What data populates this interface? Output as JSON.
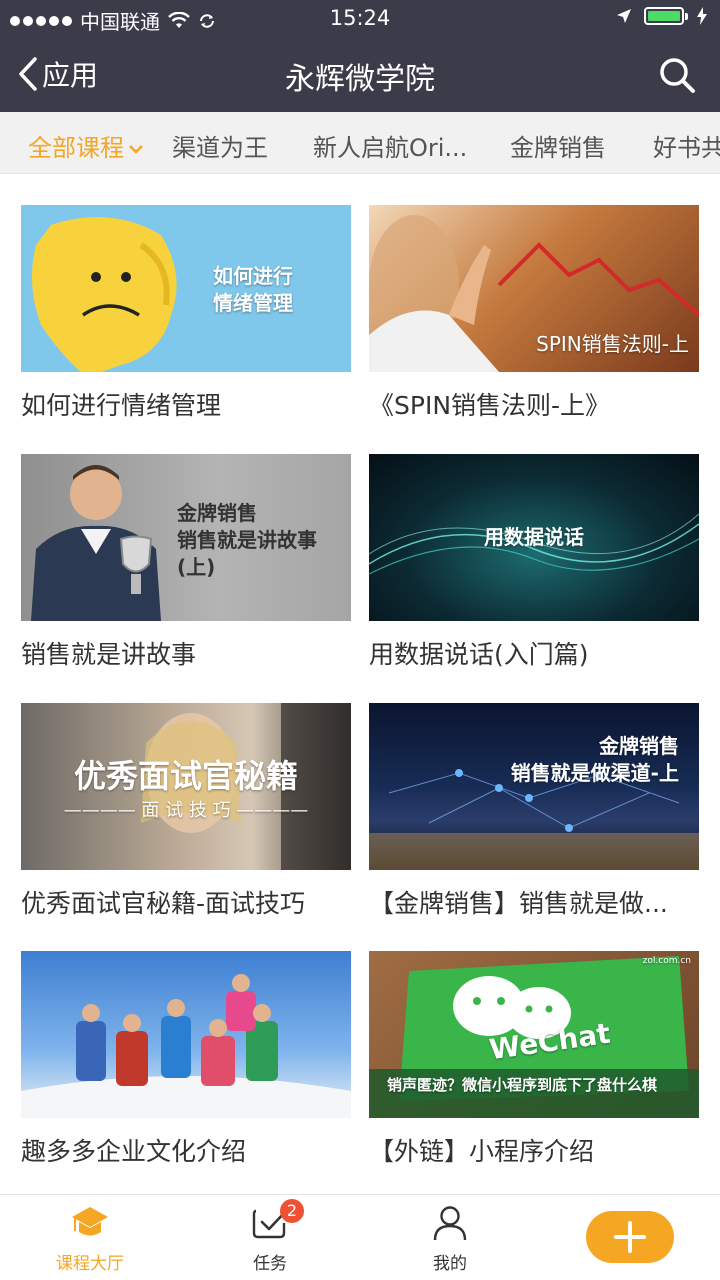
{
  "status_bar": {
    "carrier": "中国联通",
    "time": "15:24"
  },
  "nav": {
    "back_label": "应用",
    "title": "永辉微学院"
  },
  "tabs": [
    {
      "label": "全部课程",
      "active": true
    },
    {
      "label": "渠道为王"
    },
    {
      "label": "新人启航Ori..."
    },
    {
      "label": "金牌销售"
    },
    {
      "label": "好书共"
    }
  ],
  "courses": [
    {
      "title": "如何进行情绪管理",
      "thumb_text": "如何进行\n情绪管理"
    },
    {
      "title": "《SPIN销售法则-上》",
      "thumb_text": "SPIN销售法则-上"
    },
    {
      "title": "销售就是讲故事",
      "thumb_text": "金牌销售\n销售就是讲故事\n(上)"
    },
    {
      "title": "用数据说话(入门篇)",
      "thumb_text": "用数据说话"
    },
    {
      "title": "优秀面试官秘籍-面试技巧",
      "thumb_text": "优秀面试官秘籍",
      "thumb_sub": "面 试 技 巧"
    },
    {
      "title": "【金牌销售】销售就是做...",
      "thumb_text": "金牌销售\n销售就是做渠道-上"
    },
    {
      "title": "趣多多企业文化介绍",
      "thumb_text": ""
    },
    {
      "title": "【外链】小程序介绍",
      "thumb_text": "WeChat",
      "thumb_sub": "销声匿迹？微信小程序到底下了盘什么棋",
      "thumb_small": "zol.com.cn"
    }
  ],
  "bottom_tabs": [
    {
      "label": "课程大厅",
      "active": true
    },
    {
      "label": "任务",
      "badge": "2"
    },
    {
      "label": "我的"
    }
  ],
  "colors": {
    "accent": "#f5a623",
    "nav_bg": "#3b3b49",
    "badge": "#f05033"
  }
}
